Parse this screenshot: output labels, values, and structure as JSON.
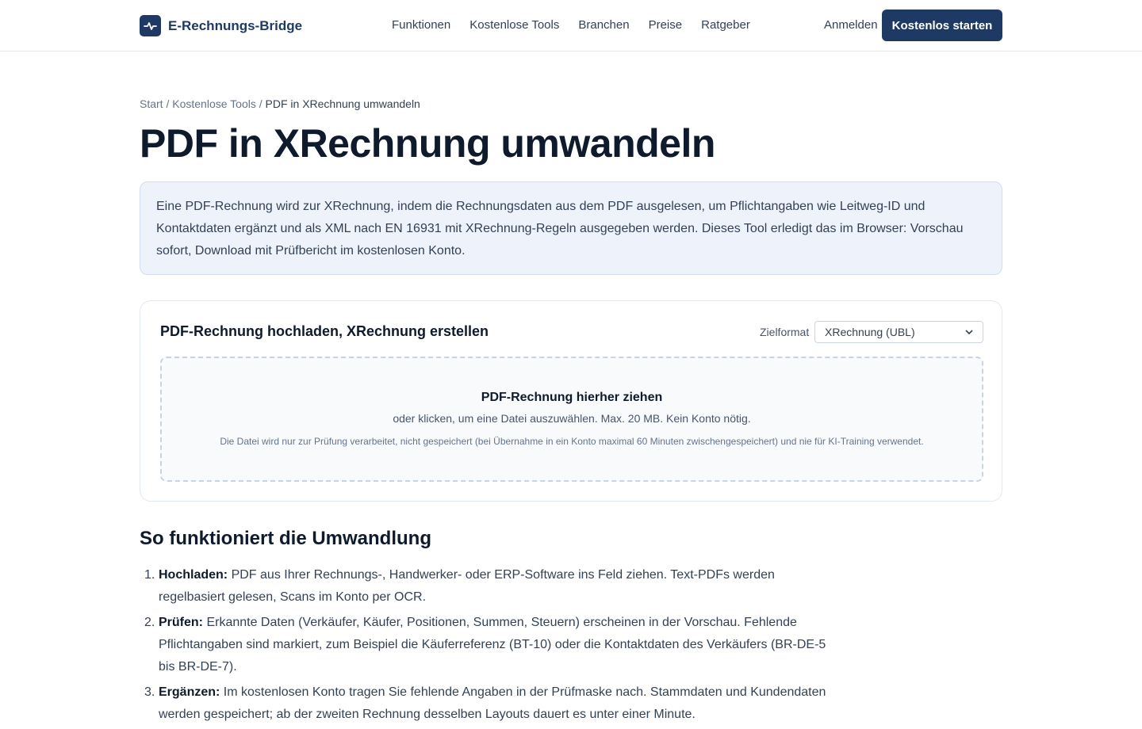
{
  "header": {
    "brand": "E-Rechnungs-Bridge",
    "nav": [
      "Funktionen",
      "Kostenlose Tools",
      "Branchen",
      "Preise",
      "Ratgeber"
    ],
    "login": "Anmelden",
    "cta": "Kostenlos starten",
    "logo_icon": "pulse-icon"
  },
  "breadcrumb": {
    "items": [
      "Start",
      "Kostenlose Tools"
    ],
    "separator": "/",
    "current": "PDF in XRechnung umwandeln"
  },
  "page_title": "PDF in XRechnung umwandeln",
  "intro": "Eine PDF-Rechnung wird zur XRechnung, indem die Rechnungsdaten aus dem PDF ausgelesen, um Pflichtangaben wie Leitweg-ID und Kontaktdaten ergänzt und als XML nach EN 16931 mit XRechnung-Regeln ausgegeben werden. Dieses Tool erledigt das im Browser: Vorschau sofort, Download mit Prüfbericht im kostenlosen Konto.",
  "tool": {
    "title": "PDF-Rechnung hochladen, XRechnung erstellen",
    "format_label": "Zielformat",
    "format_value": "XRechnung (UBL)",
    "dropzone_title": "PDF-Rechnung hierher ziehen",
    "dropzone_sub": "oder klicken, um eine Datei auszuwählen. Max. 20 MB. Kein Konto nötig.",
    "dropzone_note": "Die Datei wird nur zur Prüfung verarbeitet, nicht gespeichert (bei Übernahme in ein Konto maximal 60 Minuten zwischengespeichert) und nie für KI-Training verwendet."
  },
  "section_title": "So funktioniert die Umwandlung",
  "steps": [
    {
      "num": "1.",
      "label": "Hochladen:",
      "text": " PDF aus Ihrer Rechnungs-, Handwerker- oder ERP-Software ins Feld ziehen. Text-PDFs werden regelbasiert gelesen, Scans im Konto per OCR."
    },
    {
      "num": "2.",
      "label": "Prüfen:",
      "text": " Erkannte Daten (Verkäufer, Käufer, Positionen, Summen, Steuern) erscheinen in der Vorschau. Fehlende Pflichtangaben sind markiert, zum Beispiel die Käuferreferenz (BT-10) oder die Kontaktdaten des Verkäufers (BR-DE-5 bis BR-DE-7)."
    },
    {
      "num": "3.",
      "label": "Ergänzen:",
      "text": " Im kostenlosen Konto tragen Sie fehlende Angaben in der Prüfmaske nach. Stammdaten und Kundendaten werden gespeichert; ab der zweiten Rechnung desselben Layouts dauert es unter einer Minute."
    }
  ]
}
